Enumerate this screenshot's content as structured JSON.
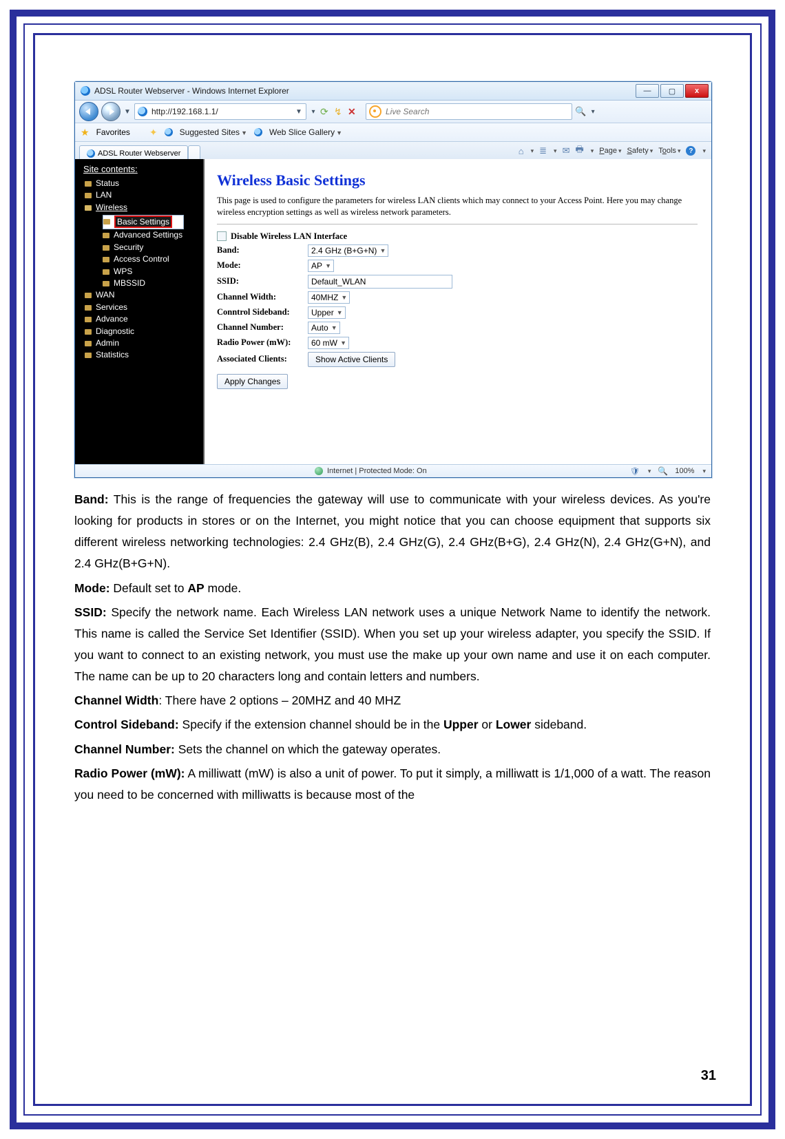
{
  "page_number": "31",
  "ie": {
    "title": "ADSL Router Webserver - Windows Internet Explorer",
    "url": "http://192.168.1.1/",
    "search_placeholder": "Live Search",
    "favorites_label": "Favorites",
    "suggested_sites": "Suggested Sites",
    "web_slice": "Web Slice Gallery",
    "tab_title": "ADSL Router Webserver",
    "menu_page": "Page",
    "menu_safety": "Safety",
    "menu_tools": "Tools",
    "status_text": "Internet | Protected Mode: On",
    "zoom": "100%"
  },
  "tree": {
    "header": "Site contents:",
    "items": {
      "status": "Status",
      "lan": "LAN",
      "wireless": "Wireless",
      "basic_settings": "Basic Settings",
      "advanced_settings": "Advanced Settings",
      "security": "Security",
      "access_control": "Access Control",
      "wps": "WPS",
      "mbssid": "MBSSID",
      "wan": "WAN",
      "services": "Services",
      "advance": "Advance",
      "diagnostic": "Diagnostic",
      "admin": "Admin",
      "statistics": "Statistics"
    }
  },
  "router": {
    "heading": "Wireless Basic Settings",
    "description": "This page is used to configure the parameters for wireless LAN clients which may connect to your Access Point. Here you may change wireless encryption settings as well as wireless network parameters.",
    "disable_label": "Disable Wireless LAN Interface",
    "labels": {
      "band": "Band:",
      "mode": "Mode:",
      "ssid": "SSID:",
      "channel_width": "Channel Width:",
      "control_sideband": "Conntrol Sideband:",
      "channel_number": "Channel Number:",
      "radio_power": "Radio Power (mW):",
      "associated_clients": "Associated Clients:"
    },
    "values": {
      "band": "2.4 GHz (B+G+N)",
      "mode": "AP",
      "ssid": "Default_WLAN",
      "channel_width": "40MHZ",
      "control_sideband": "Upper",
      "channel_number": "Auto",
      "radio_power": "60 mW"
    },
    "buttons": {
      "show_active": "Show Active Clients",
      "apply": "Apply Changes"
    }
  },
  "doc": {
    "band_label": "Band:",
    "band_text": " This is the range of frequencies the gateway will use to communicate with your wireless devices. As you're looking for products in stores or on the Internet, you might notice that you can choose equipment that supports six different wireless networking technologies: 2.4 GHz(B), 2.4 GHz(G), 2.4 GHz(B+G), 2.4 GHz(N), 2.4 GHz(G+N), and 2.4 GHz(B+G+N).",
    "mode_label": "Mode:",
    "mode_text_a": " Default set to ",
    "mode_text_b": "AP",
    "mode_text_c": " mode.",
    "ssid_label": "SSID:",
    "ssid_text": " Specify the network name. Each Wireless LAN network uses a unique Network Name to identify the network. This name is called the Service Set Identifier (SSID). When you set up your wireless adapter, you specify the SSID. If you want to connect to an existing network, you must use the make up your own name and use it on each computer. The name can be up to 20 characters long and contain letters and numbers.",
    "cw_label": "Channel Width",
    "cw_text": ": There have 2 options – 20MHZ and 40 MHZ",
    "cs_label": "Control Sideband:",
    "cs_text_a": " Specify if the extension channel should be in the ",
    "cs_upper": "Upper",
    "cs_or": " or ",
    "cs_lower": "Lower",
    "cs_text_b": " sideband.",
    "cn_label": "Channel Number:",
    "cn_text": " Sets the channel on which the gateway operates.",
    "rp_label": "Radio Power (mW):",
    "rp_text": " A milliwatt (mW) is also a unit of power. To put it simply, a milliwatt is 1/1,000 of a watt. The reason you need to be concerned with milliwatts is because most of the"
  }
}
